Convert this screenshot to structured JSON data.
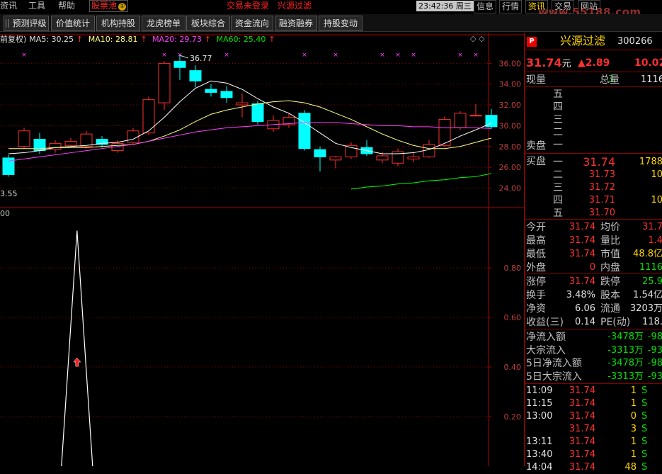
{
  "menubar": {
    "items": [
      {
        "label": "资讯",
        "x": 0
      },
      {
        "label": "工具",
        "x": 40
      },
      {
        "label": "帮助",
        "x": 82
      }
    ],
    "active_tab": {
      "label": "股票池",
      "badge": "①"
    },
    "login_status": "交易未登录",
    "stock_title": "兴源过滤",
    "clock": "23:42:36",
    "weekday": "周三",
    "right_buttons": [
      "信息",
      "行情",
      "资讯",
      "交易",
      "网站"
    ],
    "highlight_button": "资讯",
    "watermark": "www.55188.com"
  },
  "toolbar": {
    "buttons": [
      "预测评级",
      "价值统计",
      "机构持股",
      "龙虎榜单",
      "板块综合",
      "资金流向",
      "融资融券",
      "持股变动"
    ]
  },
  "chart_header": {
    "adjust": "前复权)",
    "ma5": "MA5: 30.25",
    "ma10": "MA10: 28.81",
    "ma20": "MA20: 29.73",
    "ma60": "MA60: 25.40",
    "arrow": "↑"
  },
  "indicator_label": "00",
  "chart_data": [
    {
      "type": "candlestick",
      "title": "",
      "ylim": [
        22.6,
        38.0
      ],
      "yticks": [
        24.0,
        26.0,
        28.0,
        30.0,
        32.0,
        34.0,
        36.0
      ],
      "ytick_labels": [
        "24.00",
        "26.00",
        "28.00",
        "30.00",
        "32.00",
        "34.00",
        "36.00"
      ],
      "max_label": "36.77",
      "min_label": "3.55",
      "candles": [
        {
          "o": 26.9,
          "c": 25.3,
          "h": 27.2,
          "l": 25.1
        },
        {
          "o": 28.0,
          "c": 29.5,
          "h": 29.8,
          "l": 27.8
        },
        {
          "o": 28.7,
          "c": 27.6,
          "h": 29.3,
          "l": 27.3
        },
        {
          "o": 27.7,
          "c": 28.3,
          "h": 28.6,
          "l": 27.4
        },
        {
          "o": 28.1,
          "c": 28.5,
          "h": 28.8,
          "l": 27.9
        },
        {
          "o": 28.0,
          "c": 29.2,
          "h": 29.5,
          "l": 27.8
        },
        {
          "o": 28.7,
          "c": 28.2,
          "h": 29.0,
          "l": 27.9
        },
        {
          "o": 27.6,
          "c": 28.3,
          "h": 28.6,
          "l": 27.4
        },
        {
          "o": 28.4,
          "c": 29.5,
          "h": 29.8,
          "l": 28.2
        },
        {
          "o": 29.3,
          "c": 32.5,
          "h": 32.8,
          "l": 29.1
        },
        {
          "o": 32.2,
          "c": 36.0,
          "h": 36.2,
          "l": 31.5
        },
        {
          "o": 36.2,
          "c": 35.6,
          "h": 36.77,
          "l": 34.4
        },
        {
          "o": 35.3,
          "c": 34.3,
          "h": 35.8,
          "l": 33.7
        },
        {
          "o": 33.5,
          "c": 33.2,
          "h": 34.0,
          "l": 32.8
        },
        {
          "o": 33.3,
          "c": 32.7,
          "h": 33.8,
          "l": 32.2
        },
        {
          "o": 32.0,
          "c": 32.2,
          "h": 33.1,
          "l": 30.8
        },
        {
          "o": 32.1,
          "c": 30.4,
          "h": 32.4,
          "l": 30.1
        },
        {
          "o": 29.7,
          "c": 30.5,
          "h": 31.0,
          "l": 29.4
        },
        {
          "o": 30.1,
          "c": 30.8,
          "h": 31.2,
          "l": 29.8
        },
        {
          "o": 31.2,
          "c": 27.8,
          "h": 31.5,
          "l": 27.6
        },
        {
          "o": 27.7,
          "c": 27.0,
          "h": 28.0,
          "l": 25.6
        },
        {
          "o": 26.7,
          "c": 27.0,
          "h": 27.1,
          "l": 25.9
        },
        {
          "o": 27.0,
          "c": 28.1,
          "h": 28.4,
          "l": 26.8
        },
        {
          "o": 27.9,
          "c": 27.3,
          "h": 28.6,
          "l": 27.1
        },
        {
          "o": 26.7,
          "c": 27.1,
          "h": 27.5,
          "l": 26.4
        },
        {
          "o": 26.4,
          "c": 27.5,
          "h": 27.8,
          "l": 26.1
        },
        {
          "o": 26.8,
          "c": 27.0,
          "h": 27.5,
          "l": 26.5
        },
        {
          "o": 27.0,
          "c": 28.2,
          "h": 28.6,
          "l": 26.9
        },
        {
          "o": 28.1,
          "c": 30.6,
          "h": 30.9,
          "l": 27.9
        },
        {
          "o": 29.8,
          "c": 31.2,
          "h": 31.4,
          "l": 29.6
        },
        {
          "o": 31.0,
          "c": 31.0,
          "h": 32.1,
          "l": 30.9
        },
        {
          "o": 31.0,
          "c": 29.9,
          "h": 31.6,
          "l": 29.7
        }
      ],
      "series": [
        {
          "name": "MA5",
          "color": "#ffffff",
          "values": [
            27.3,
            27.4,
            27.6,
            27.9,
            28.0,
            28.1,
            28.3,
            28.4,
            28.7,
            29.5,
            30.8,
            32.3,
            33.6,
            34.3,
            34.1,
            33.5,
            32.6,
            31.8,
            31.2,
            30.3,
            29.3,
            28.3,
            27.9,
            27.6,
            27.3,
            27.3,
            27.4,
            27.7,
            28.3,
            29.0,
            29.6,
            30.25
          ]
        },
        {
          "name": "MA10",
          "color": "#ffff80",
          "values": [
            27.8,
            27.8,
            27.8,
            27.9,
            27.9,
            27.9,
            28.0,
            28.1,
            28.2,
            28.5,
            29.0,
            29.6,
            30.4,
            31.1,
            31.5,
            31.8,
            32.1,
            32.3,
            32.4,
            32.2,
            31.8,
            31.2,
            30.6,
            29.9,
            29.2,
            28.6,
            28.1,
            27.8,
            27.8,
            28.0,
            28.4,
            28.81
          ]
        },
        {
          "name": "MA20",
          "color": "#ff40ff",
          "values": [
            26.6,
            26.8,
            27.0,
            27.2,
            27.4,
            27.6,
            27.8,
            28.0,
            28.2,
            28.5,
            28.8,
            29.1,
            29.4,
            29.6,
            29.8,
            29.9,
            30.0,
            30.1,
            30.2,
            30.3,
            30.3,
            30.3,
            30.2,
            30.1,
            30.0,
            30.0,
            29.9,
            29.9,
            29.8,
            29.8,
            29.8,
            29.73
          ]
        },
        {
          "name": "MA60",
          "color": "#00ff00",
          "start_index": 22,
          "values": [
            23.9,
            24.1,
            24.2,
            24.4,
            24.5,
            24.7,
            24.8,
            25.0,
            25.1,
            25.4
          ]
        }
      ],
      "x_markers": [
        1,
        10,
        11,
        14,
        19,
        21,
        24,
        25,
        26,
        29,
        30
      ]
    },
    {
      "type": "line",
      "title": "",
      "ylim": [
        0.0,
        1.0
      ],
      "yticks": [
        0.2,
        0.4,
        0.6,
        0.8
      ],
      "ytick_labels": [
        "0.20",
        "0.40",
        "0.60",
        "0.80"
      ],
      "series": [
        {
          "name": "",
          "color": "#ffffff",
          "x": [
            3.4,
            4.4,
            5.4
          ],
          "values": [
            0.0,
            0.95,
            0.0
          ]
        }
      ],
      "arrow_at": {
        "x": 4.4,
        "y": 0.42
      }
    }
  ],
  "quote": {
    "name": "兴源过滤",
    "code": "300266",
    "price": "31.74",
    "unit": "元",
    "change": "▲2.89",
    "pct": "10.02",
    "xianliang_label": "现量",
    "xianliang": "3",
    "zongliang_label": "总量",
    "zongliang": "1116",
    "sell_label": "卖盘",
    "buy_label": "买盘",
    "sell_levels": [
      "五",
      "四",
      "三",
      "二",
      "一"
    ],
    "buy_levels": [
      {
        "lvl": "一",
        "price": "31.74",
        "vol": "1788"
      },
      {
        "lvl": "二",
        "price": "31.73",
        "vol": "10"
      },
      {
        "lvl": "三",
        "price": "31.72",
        "vol": ""
      },
      {
        "lvl": "四",
        "price": "31.71",
        "vol": "10"
      },
      {
        "lvl": "五",
        "price": "31.70",
        "vol": ""
      }
    ],
    "stats": [
      {
        "l1": "今开",
        "v1": "31.74",
        "c1": "r",
        "l2": "均价",
        "v2": "31.7",
        "c2": "r"
      },
      {
        "l1": "最高",
        "v1": "31.74",
        "c1": "r",
        "l2": "量比",
        "v2": "1.4",
        "c2": "r"
      },
      {
        "l1": "最低",
        "v1": "31.74",
        "c1": "r",
        "l2": "市值",
        "v2": "48.8亿",
        "c2": "y"
      },
      {
        "l1": "外盘",
        "v1": "0",
        "c1": "r",
        "l2": "内盘",
        "v2": "1116",
        "c2": "g"
      }
    ],
    "stats2": [
      {
        "l1": "涨停",
        "v1": "31.74",
        "c1": "r",
        "l2": "跌停",
        "v2": "25.9",
        "c2": "g"
      },
      {
        "l1": "换手",
        "v1": "3.48%",
        "c1": "w",
        "l2": "股本",
        "v2": "1.54亿",
        "c2": "w"
      },
      {
        "l1": "净资",
        "v1": "6.06",
        "c1": "w",
        "l2": "流通",
        "v2": "3203万",
        "c2": "w"
      },
      {
        "l1": "收益(三)",
        "v1": "0.14",
        "c1": "w",
        "l2": "PE(动)",
        "v2": "118.",
        "c2": "w"
      }
    ],
    "flows": [
      {
        "label": "净流入额",
        "value": "-3478万",
        "pct": "-98"
      },
      {
        "label": "大宗流入",
        "value": "-3313万",
        "pct": "-93"
      },
      {
        "label": "5日净流入额",
        "value": "-3478万",
        "pct": "-98"
      },
      {
        "label": "5日大宗流入",
        "value": "-3313万",
        "pct": "-93"
      }
    ],
    "ticks": [
      {
        "time": "11:09",
        "price": "31.74",
        "vol": "1",
        "side": "S"
      },
      {
        "time": "11:15",
        "price": "31.74",
        "vol": "1",
        "side": "S"
      },
      {
        "time": "13:00",
        "price": "31.74",
        "vol": "0",
        "side": "S"
      },
      {
        "time": "",
        "price": "31.74",
        "vol": "3",
        "side": "S"
      },
      {
        "time": "13:11",
        "price": "31.74",
        "vol": "1",
        "side": "S"
      },
      {
        "time": "13:40",
        "price": "31.74",
        "vol": "1",
        "side": "S"
      },
      {
        "time": "14:04",
        "price": "31.74",
        "vol": "48",
        "side": "S"
      }
    ]
  },
  "colors": {
    "up": "#ff3030",
    "down": "#00ffff",
    "grid": "#8b0000"
  }
}
